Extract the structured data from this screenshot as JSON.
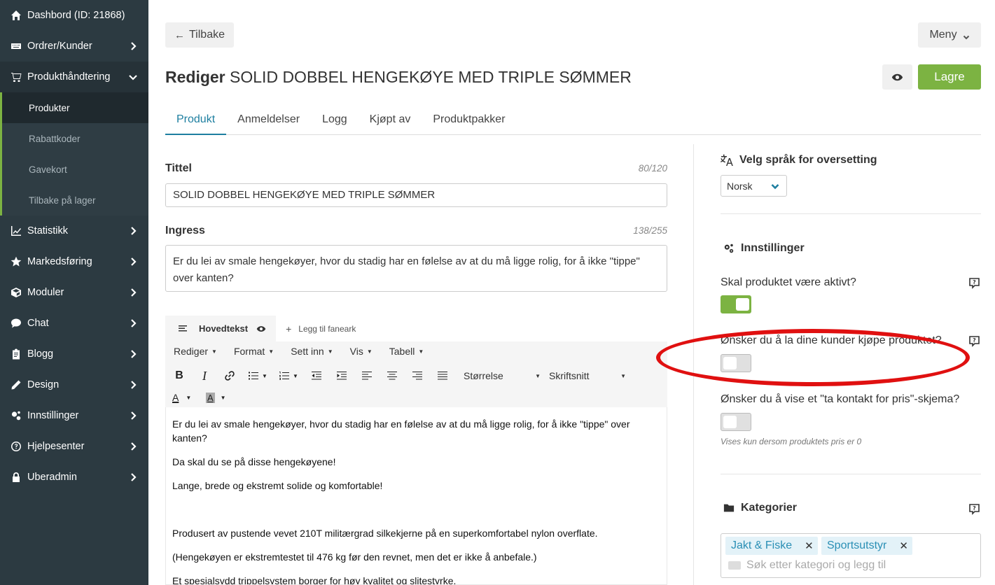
{
  "sidebar": {
    "items": [
      {
        "label": "Dashbord (ID: 21868)",
        "icon": "home-icon"
      },
      {
        "label": "Ordrer/Kunder",
        "icon": "keyboard-icon"
      },
      {
        "label": "Produkthåndtering",
        "icon": "cart-icon"
      },
      {
        "label": "Statistikk",
        "icon": "line-chart-icon"
      },
      {
        "label": "Markedsføring",
        "icon": "star-icon"
      },
      {
        "label": "Moduler",
        "icon": "cube-icon"
      },
      {
        "label": "Chat",
        "icon": "chat-bubble-icon"
      },
      {
        "label": "Blogg",
        "icon": "clipboard-icon"
      },
      {
        "label": "Design",
        "icon": "pencil-icon"
      },
      {
        "label": "Innstillinger",
        "icon": "cogs-icon"
      },
      {
        "label": "Hjelpesenter",
        "icon": "question-circle-icon"
      },
      {
        "label": "Uberadmin",
        "icon": "lock-icon"
      }
    ],
    "submenu": [
      "Produkter",
      "Rabattkoder",
      "Gavekort",
      "Tilbake på lager"
    ]
  },
  "header": {
    "back_label": "Tilbake",
    "menu_label": "Meny",
    "title_prefix": "Rediger",
    "title_name": "SOLID DOBBEL HENGEKØYE MED TRIPLE SØMMER",
    "save_label": "Lagre"
  },
  "tabs": [
    "Produkt",
    "Anmeldelser",
    "Logg",
    "Kjøpt av",
    "Produktpakker"
  ],
  "form": {
    "title_label": "Tittel",
    "title_count": "80/120",
    "title_value": "SOLID DOBBEL HENGEKØYE MED TRIPLE SØMMER",
    "ingress_label": "Ingress",
    "ingress_count": "138/255",
    "ingress_value": "Er du lei av smale hengekøyer, hvor du stadig har en følelse av at du må ligge rolig, for å ikke \"tippe\" over kanten?"
  },
  "editor": {
    "main_tab": "Hovedtekst",
    "add_tab": "Legg til faneark",
    "menus": [
      "Rediger",
      "Format",
      "Sett inn",
      "Vis",
      "Tabell"
    ],
    "size_label": "Størrelse",
    "font_label": "Skriftsnitt",
    "paragraphs": [
      "Er du lei av smale hengekøyer, hvor du stadig har en følelse av at du må ligge rolig, for å ikke \"tippe\" over kanten?",
      "Da skal du se på disse hengekøyene!",
      "Lange, brede og ekstremt solide og komfortable!",
      "",
      "Produsert av pustende vevet 210T militærgrad silkekjerne på en superkomfortabel nylon overflate.",
      "(Hengekøyen er ekstremtestet til 476 kg før den revnet, men det er ikke å anbefale.)",
      "Et spesialsydd trippelsystem borger for høy kvalitet og slitestyrke."
    ]
  },
  "right": {
    "lang_title": "Velg språk for oversetting",
    "lang_value": "Norsk",
    "settings_title": "Innstillinger",
    "q_active": "Skal produktet være aktivt?",
    "q_buy": "Ønsker du å la dine kunder kjøpe produktet?",
    "q_contact": "Ønsker du å vise et \"ta kontakt for pris\"-skjema?",
    "contact_hint": "Vises kun dersom produktets pris er 0",
    "active_on": true,
    "buy_on": false,
    "contact_on": false,
    "categories_title": "Kategorier",
    "categories": [
      "Jakt & Fiske",
      "Sportsutstyr"
    ],
    "category_placeholder": "Søk etter kategori og legg til"
  },
  "colors": {
    "sidebar_bg": "#2c3a41",
    "accent_green": "#7cb342",
    "tab_active": "#1e7fa0",
    "annotation_red": "#e01010"
  }
}
